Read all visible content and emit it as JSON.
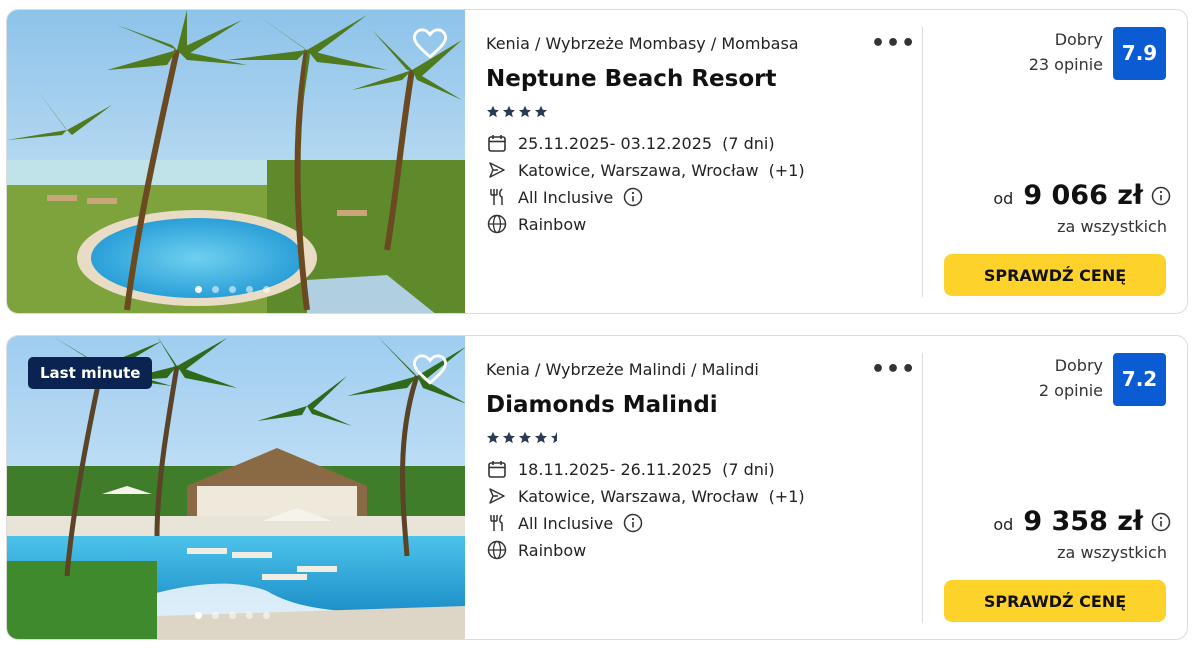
{
  "offers": [
    {
      "badge": "",
      "breadcrumb": "Kenia / Wybrzeże Mombasy / Mombasa",
      "title": "Neptune Beach Resort",
      "stars": 4,
      "dates": "25.11.2025- 03.12.2025",
      "duration": "(7 dni)",
      "departures": "Katowice, Warszawa, Wrocław",
      "departures_extra": "(+1)",
      "board": "All Inclusive",
      "operator": "Rainbow",
      "rating_word": "Dobry",
      "rating_count": "23 opinie",
      "score": "7.9",
      "price_from": "od",
      "price": "9 066 zł",
      "price_note": "za wszystkich",
      "cta": "SPRAWDŹ CENĘ",
      "more": "•••"
    },
    {
      "badge": "Last minute",
      "breadcrumb": "Kenia / Wybrzeże Malindi / Malindi",
      "title": "Diamonds Malindi",
      "stars": 4.5,
      "dates": "18.11.2025- 26.11.2025",
      "duration": "(7 dni)",
      "departures": "Katowice, Warszawa, Wrocław",
      "departures_extra": "(+1)",
      "board": "All Inclusive",
      "operator": "Rainbow",
      "rating_word": "Dobry",
      "rating_count": "2 opinie",
      "score": "7.2",
      "price_from": "od",
      "price": "9 358 zł",
      "price_note": "za wszystkich",
      "cta": "SPRAWDŹ CENĘ",
      "more": "•••"
    }
  ],
  "colors": {
    "score_bg": "#0b5bd3",
    "cta_bg": "#fdd22a",
    "badge_bg": "#0b2350",
    "star": "#2b3a55"
  },
  "icons": [
    "heart-icon",
    "calendar-icon",
    "plane-icon",
    "fork-knife-icon",
    "globe-icon",
    "info-icon",
    "more-icon"
  ]
}
